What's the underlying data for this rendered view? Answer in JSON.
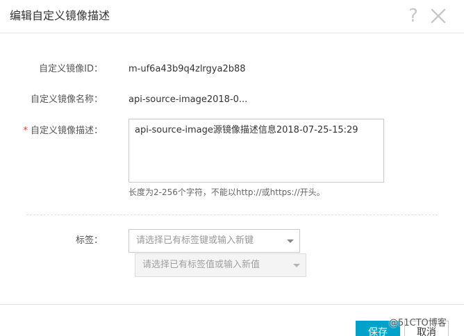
{
  "dialog": {
    "title": "编辑自定义镜像描述",
    "help_icon": "question-mark-icon",
    "close_icon": "close-icon"
  },
  "form": {
    "image_id": {
      "label": "自定义镜像ID：",
      "value": "m-uf6a43b9q4zlrgya2b88"
    },
    "image_name": {
      "label": "自定义镜像名称：",
      "value": "api-source-image2018-0..."
    },
    "image_description": {
      "required_mark": "*",
      "label": "自定义镜像描述：",
      "value": "api-source-image源镜像描述信息2018-07-25-15:29",
      "hint": "长度为2-256个字符，不能以http://或https://开头。"
    },
    "tags": {
      "label": "标签：",
      "key_placeholder": "请选择已有标签键或输入新键",
      "value_placeholder": "请选择已有标签值或输入新值"
    }
  },
  "footer": {
    "save_label": "保存",
    "cancel_label": "取消"
  },
  "watermark": "@51CTO博客",
  "colors": {
    "primary": "#00a2ca",
    "required": "#e4393c"
  }
}
